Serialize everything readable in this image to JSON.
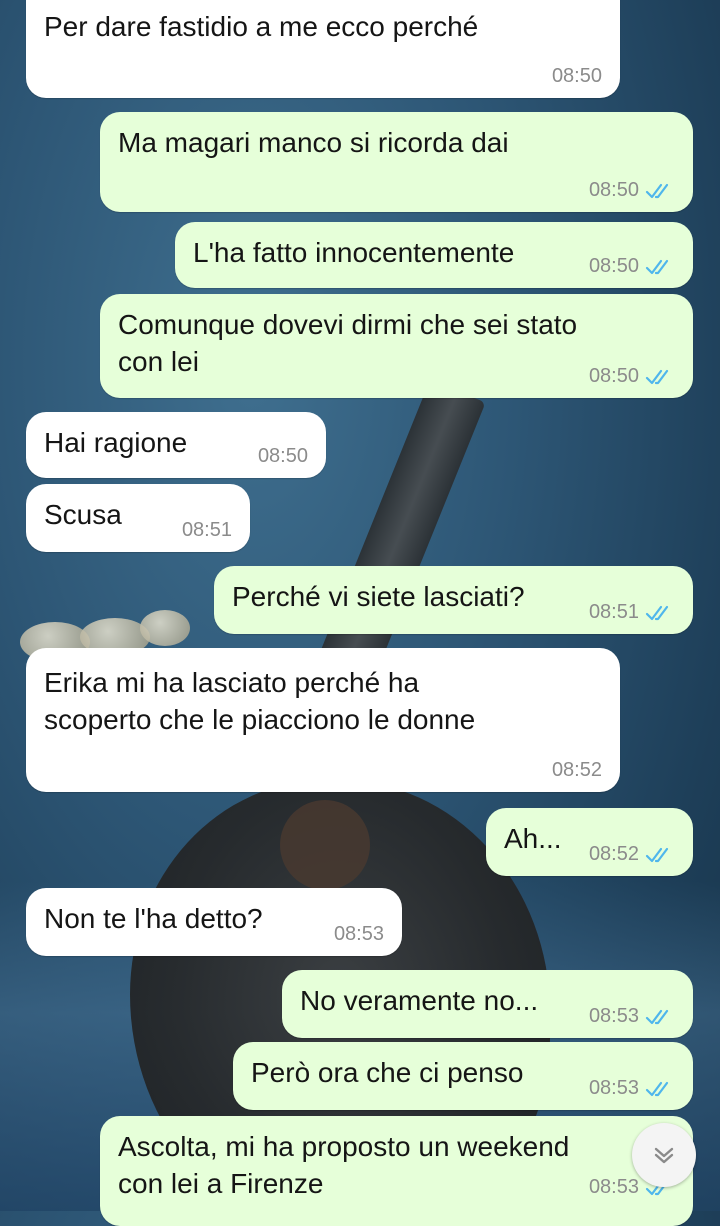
{
  "chat": {
    "messages": [
      {
        "text": "Per dare fastidio a me ecco perché",
        "time": "08:50"
      },
      {
        "text": "Ma magari manco si ricorda dai",
        "time": "08:50"
      },
      {
        "text": "L'ha fatto innocentemente",
        "time": "08:50"
      },
      {
        "text": "Comunque dovevi dirmi che sei stato\ncon lei",
        "time": "08:50"
      },
      {
        "text": "Hai ragione",
        "time": "08:50"
      },
      {
        "text": "Scusa",
        "time": "08:51"
      },
      {
        "text": "Perché vi siete lasciati?",
        "time": "08:51"
      },
      {
        "text": "Erika mi ha lasciato perché ha\nscoperto che le piacciono le donne",
        "time": "08:52"
      },
      {
        "text": "Ah...",
        "time": "08:52"
      },
      {
        "text": "Non te l'ha detto?",
        "time": "08:53"
      },
      {
        "text": "No veramente no...",
        "time": "08:53"
      },
      {
        "text": "Però ora che ci penso",
        "time": "08:53"
      },
      {
        "text": "Ascolta, mi ha proposto un weekend\ncon lei a Firenze",
        "time": "08:53"
      }
    ]
  },
  "colors": {
    "incoming_bubble": "#ffffff",
    "outgoing_bubble": "#e6ffd9",
    "read_ticks": "#4fb6ec"
  },
  "icons": {
    "ticks": "double-check-icon",
    "scroll": "chevron-down-icon"
  }
}
